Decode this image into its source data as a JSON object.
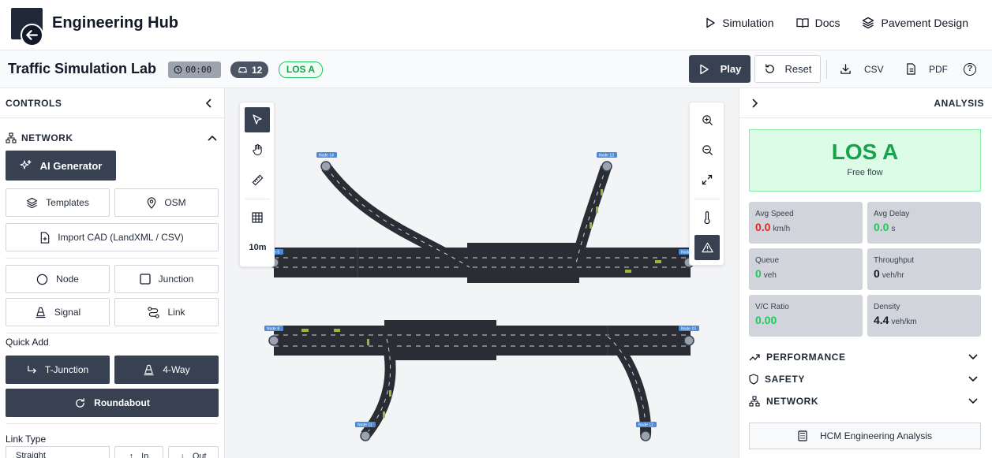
{
  "app": {
    "title": "Engineering Hub"
  },
  "nav": [
    {
      "label": "Simulation",
      "icon": "play-icon"
    },
    {
      "label": "Docs",
      "icon": "book-icon"
    },
    {
      "label": "Pavement Design",
      "icon": "layers-icon"
    }
  ],
  "toolbar": {
    "lab_title": "Traffic Simulation Lab",
    "time": "00:00",
    "vehicle_count": "12",
    "los_badge": "LOS A",
    "play_label": "Play",
    "reset_label": "Reset",
    "csv_label": "CSV",
    "pdf_label": "PDF"
  },
  "controls": {
    "title": "CONTROLS",
    "network_title": "NETWORK",
    "ai_generator": "AI Generator",
    "templates": "Templates",
    "osm": "OSM",
    "import_cad": "Import CAD (LandXML / CSV)",
    "node": "Node",
    "junction": "Junction",
    "signal": "Signal",
    "link": "Link",
    "quick_add": "Quick Add",
    "t_junction": "T-Junction",
    "four_way": "4-Way",
    "roundabout": "Roundabout",
    "link_type": "Link Type",
    "link_type_value": "Straight",
    "in_label": "In",
    "out_label": "Out"
  },
  "canvas": {
    "scale_label": "10m",
    "nodes": [
      "Node 14",
      "Node 13",
      "Node 5",
      "Node 6",
      "Node 8",
      "Node 10",
      "Node 11",
      "Node 12"
    ]
  },
  "analysis": {
    "title": "ANALYSIS",
    "los": "LOS A",
    "los_desc": "Free flow",
    "metrics": [
      {
        "label": "Avg Speed",
        "value": "0.0",
        "unit": "km/h",
        "color": "#dc2626"
      },
      {
        "label": "Avg Delay",
        "value": "0.0",
        "unit": "s",
        "color": "#22c55e"
      },
      {
        "label": "Queue",
        "value": "0",
        "unit": "veh",
        "color": "#22c55e"
      },
      {
        "label": "Throughput",
        "value": "0",
        "unit": "veh/hr",
        "color": "#111827"
      },
      {
        "label": "V/C Ratio",
        "value": "0.00",
        "unit": "",
        "color": "#22c55e"
      },
      {
        "label": "Density",
        "value": "4.4",
        "unit": "veh/km",
        "color": "#111827"
      }
    ],
    "sections": [
      "PERFORMANCE",
      "SAFETY",
      "NETWORK"
    ],
    "hcm_label": "HCM Engineering Analysis"
  }
}
